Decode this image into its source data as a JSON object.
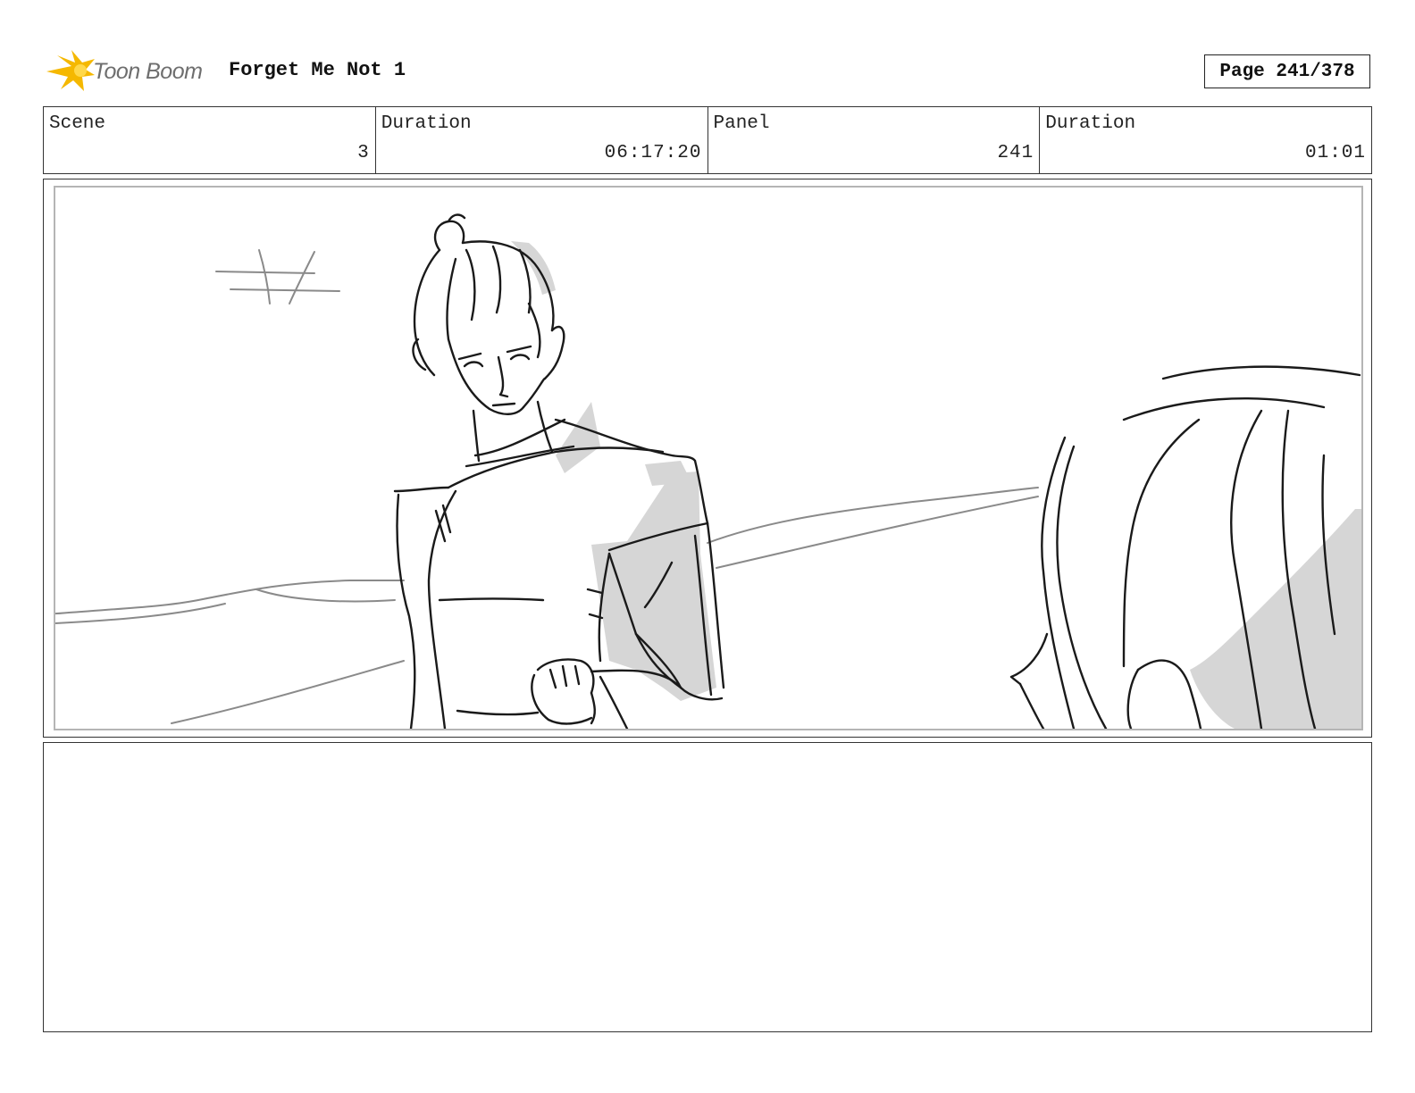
{
  "header": {
    "logo_text": "Toon Boom",
    "project_title": "Forget Me Not 1",
    "page_label": "Page 241/378"
  },
  "info": {
    "scene_label": "Scene",
    "scene_value": "3",
    "scene_duration_label": "Duration",
    "scene_duration_value": "06:17:20",
    "panel_label": "Panel",
    "panel_value": "241",
    "panel_duration_label": "Duration",
    "panel_duration_value": "01:01"
  },
  "colors": {
    "logo_flame": "#f5b800",
    "sketch_line": "#1a1a1a",
    "sketch_tone": "#d4d4d4",
    "frame_border": "#333333"
  },
  "notes": {
    "text": ""
  }
}
